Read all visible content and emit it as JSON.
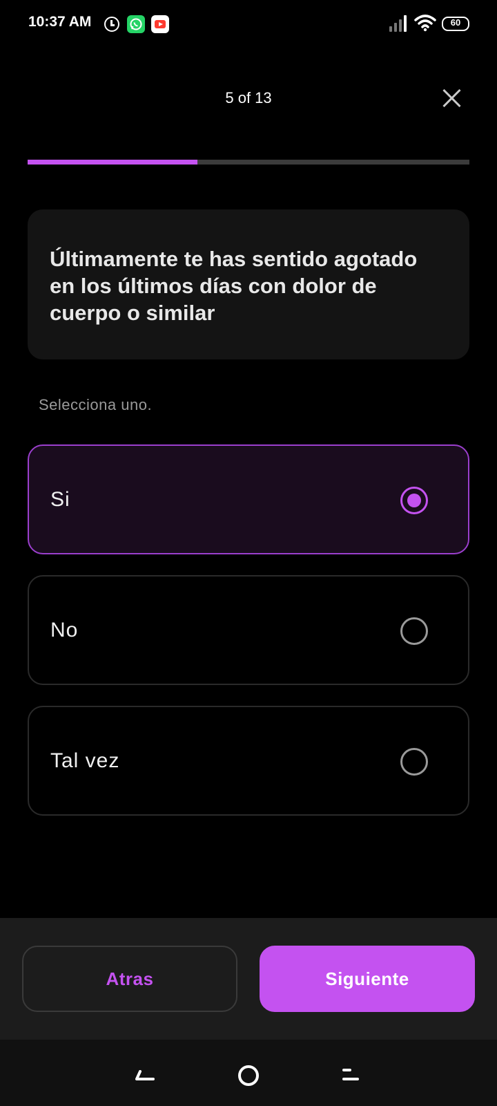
{
  "status_bar": {
    "time": "10:37 AM",
    "battery": "60",
    "icons": [
      "clock-icon",
      "whatsapp-icon",
      "youtube-icon",
      "signal-icon",
      "wifi-icon",
      "battery-icon"
    ]
  },
  "header": {
    "step_counter": "5 of 13",
    "close_icon": "close-icon"
  },
  "progress": {
    "current": 5,
    "total": 13,
    "fraction": 0.385,
    "fill_color": "#c452f0",
    "track_color": "#3b3b3b"
  },
  "question": {
    "text": "Últimamente te has sentido agotado en los últimos días con dolor de cuerpo o similar"
  },
  "hint": "Selecciona uno.",
  "options": [
    {
      "label": "Si",
      "selected": true
    },
    {
      "label": "No",
      "selected": false
    },
    {
      "label": "Tal vez",
      "selected": false
    }
  ],
  "buttons": {
    "back_label": "Atras",
    "next_label": "Siguiente"
  },
  "colors": {
    "accent": "#c452f0",
    "background": "#000000",
    "card": "#141414",
    "selected_bg": "#1a0c1e"
  }
}
